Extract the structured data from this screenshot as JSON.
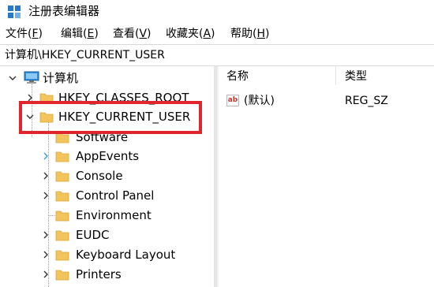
{
  "window": {
    "title": "注册表编辑器",
    "app_icon": "regedit-icon"
  },
  "menubar": {
    "items": [
      {
        "label": "文件",
        "accel": "F"
      },
      {
        "label": "编辑",
        "accel": "E"
      },
      {
        "label": "查看",
        "accel": "V"
      },
      {
        "label": "收藏夹",
        "accel": "A"
      },
      {
        "label": "帮助",
        "accel": "H"
      }
    ]
  },
  "address": {
    "path": "计算机\\HKEY_CURRENT_USER"
  },
  "tree": {
    "root": {
      "label": "计算机",
      "icon": "computer-icon",
      "state": "expanded"
    },
    "hives": [
      {
        "label": "HKEY_CLASSES_ROOT",
        "state": "collapsed"
      },
      {
        "label": "HKEY_CURRENT_USER",
        "state": "expanded",
        "selected": true
      }
    ],
    "children": [
      {
        "label": "Software",
        "has_children": false
      },
      {
        "label": "AppEvents",
        "has_children": true
      },
      {
        "label": "Console",
        "has_children": true
      },
      {
        "label": "Control Panel",
        "has_children": true
      },
      {
        "label": "Environment",
        "has_children": false
      },
      {
        "label": "EUDC",
        "has_children": true
      },
      {
        "label": "Keyboard Layout",
        "has_children": true
      },
      {
        "label": "Printers",
        "has_children": true
      }
    ]
  },
  "values": {
    "columns": {
      "name": "名称",
      "type": "类型"
    },
    "rows": [
      {
        "icon": "string-value-icon",
        "icon_glyph": "ab",
        "name": "(默认)",
        "type": "REG_SZ"
      }
    ]
  },
  "colors": {
    "highlight_border": "#e0262c",
    "folder": "#f2c45b",
    "expander_hover": "#3a9ad9"
  }
}
